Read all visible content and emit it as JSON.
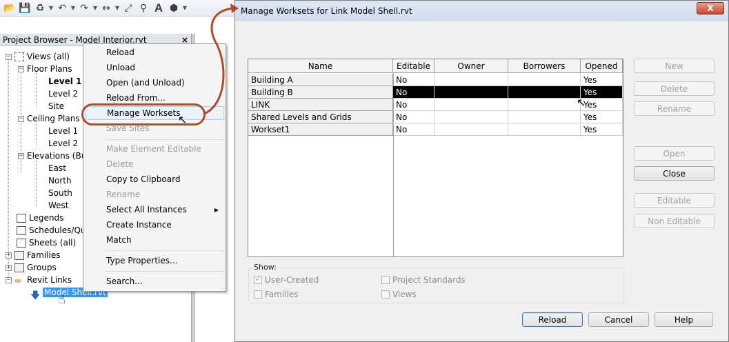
{
  "toolbar": {
    "icons": [
      "open-icon",
      "save-icon",
      "sync-icon",
      "undo-icon",
      "redo-icon",
      "measure-icon",
      "dimension-icon",
      "tag-icon",
      "text-icon",
      "3d-view-icon"
    ],
    "text_tool": "A"
  },
  "project_browser": {
    "title": "Project Browser - Model Interior.rvt",
    "close": "×",
    "tree": {
      "views": "Views (all)",
      "floor_plans": "Floor Plans",
      "level1": "Level 1",
      "level2": "Level 2",
      "site": "Site",
      "ceiling_plans": "Ceiling Plans",
      "c_level1": "Level 1",
      "c_level2": "Level 2",
      "elevations": "Elevations (Bu",
      "east": "East",
      "north": "North",
      "south": "South",
      "west": "West",
      "legends": "Legends",
      "schedules": "Schedules/Qu",
      "sheets": "Sheets (all)",
      "families": "Families",
      "groups": "Groups",
      "revit_links": "Revit Links",
      "model_shell": "Model Shell.rvt"
    }
  },
  "context_menu": {
    "reload": "Reload",
    "unload": "Unload",
    "open_unload": "Open (and Unload)",
    "reload_from": "Reload From...",
    "manage_worksets": "Manage Worksets",
    "save_sites": "Save Sites",
    "make_editable": "Make Element Editable",
    "delete": "Delete",
    "copy_clipboard": "Copy to Clipboard",
    "rename": "Rename",
    "select_all": "Select All Instances",
    "create_instance": "Create Instance",
    "match": "Match",
    "type_properties": "Type Properties...",
    "search": "Search..."
  },
  "dialog": {
    "title": "Manage Worksets for Link Model Shell.rvt",
    "close": "X",
    "columns": [
      "Name",
      "Editable",
      "Owner",
      "Borrowers",
      "Opened"
    ],
    "rows": [
      {
        "name": "Building A",
        "editable": "No",
        "owner": "",
        "borrowers": "",
        "opened": "Yes"
      },
      {
        "name": "Building B",
        "editable": "No",
        "owner": "",
        "borrowers": "",
        "opened": "Yes"
      },
      {
        "name": "LINK",
        "editable": "No",
        "owner": "",
        "borrowers": "",
        "opened": "Yes"
      },
      {
        "name": "Shared Levels and Grids",
        "editable": "No",
        "owner": "",
        "borrowers": "",
        "opened": "Yes"
      },
      {
        "name": "Workset1",
        "editable": "No",
        "owner": "",
        "borrowers": "",
        "opened": "Yes"
      }
    ],
    "buttons": {
      "new": "New",
      "delete": "Delete",
      "rename": "Rename",
      "open": "Open",
      "close": "Close",
      "editable": "Editable",
      "non_editable": "Non Editable",
      "reload": "Reload",
      "cancel": "Cancel",
      "help": "Help"
    },
    "show": {
      "label": "Show:",
      "user_created": "User-Created",
      "families": "Families",
      "project_standards": "Project Standards",
      "views": "Views"
    }
  },
  "colors": {
    "highlight_ring": "#b24a2a",
    "selection": "#3399ff",
    "selected_row": "#000000"
  }
}
